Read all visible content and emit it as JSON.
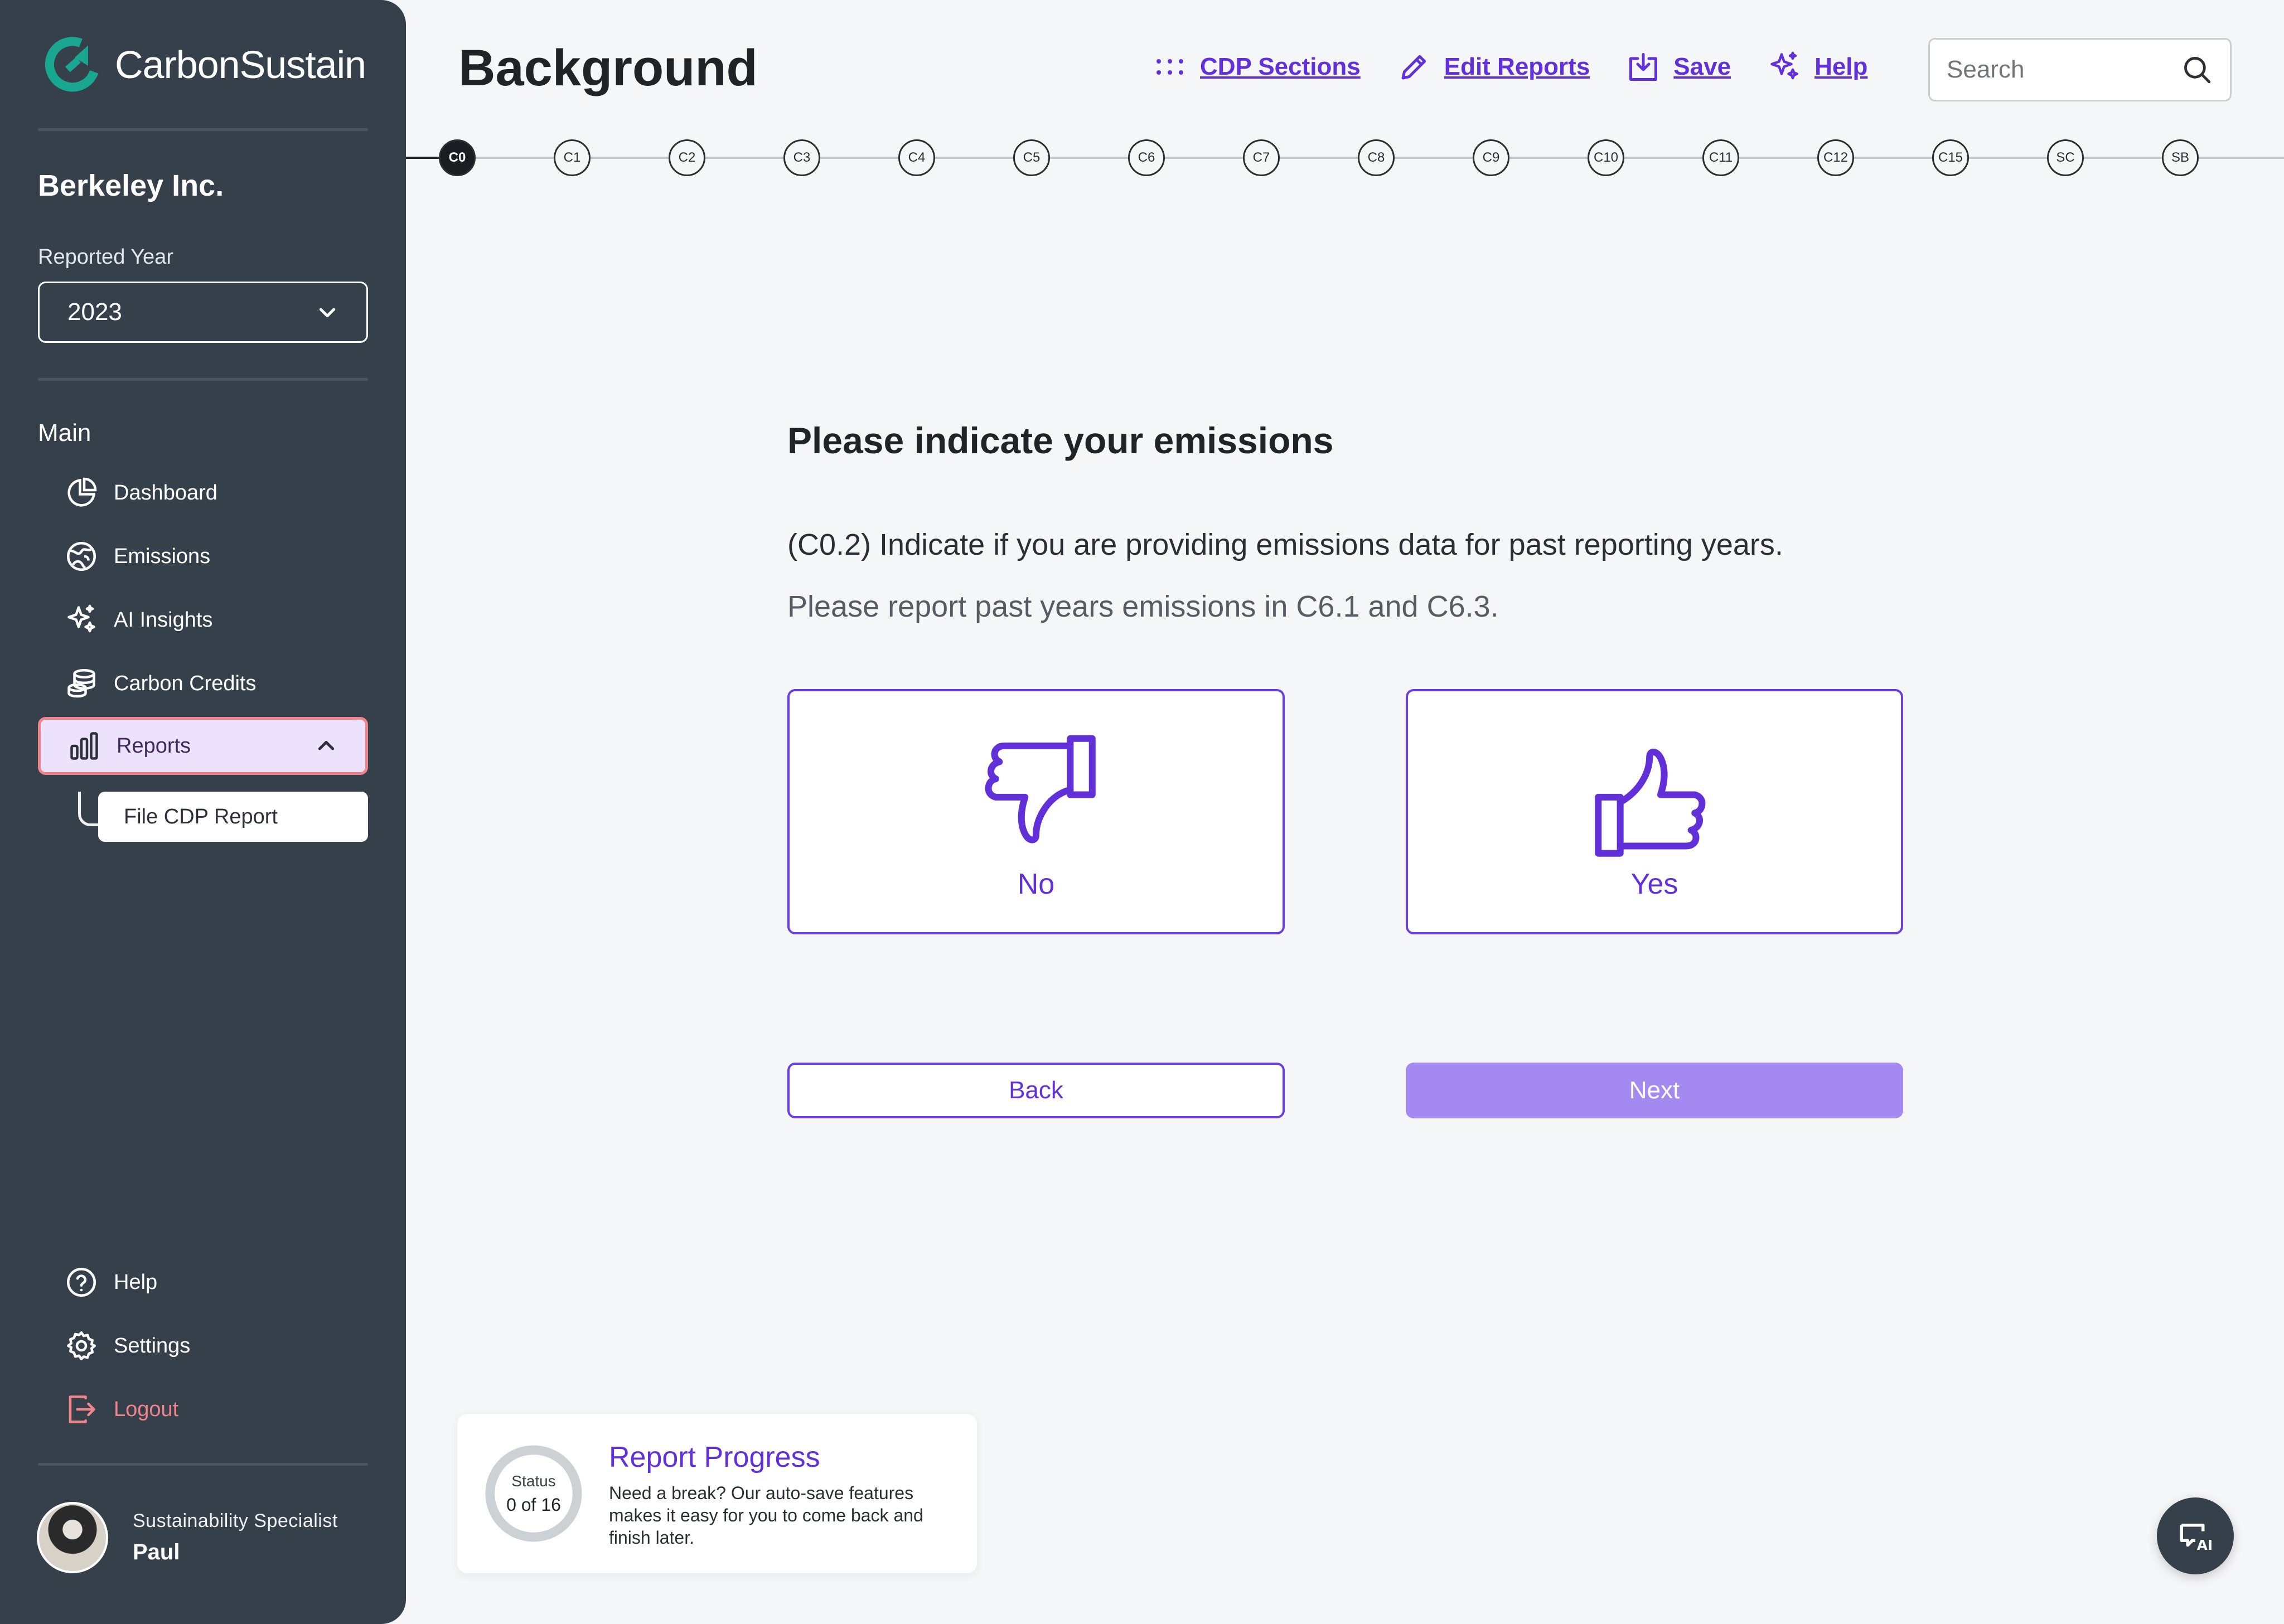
{
  "brand": {
    "name": "CarbonSustain",
    "accent": "#6230d9",
    "logo_color": "#1aa792"
  },
  "sidebar": {
    "company": "Berkeley Inc.",
    "year_label": "Reported Year",
    "year_value": "2023",
    "main_label": "Main",
    "items": [
      {
        "label": "Dashboard",
        "icon": "pie-chart-icon"
      },
      {
        "label": "Emissions",
        "icon": "globe-icon"
      },
      {
        "label": "AI Insights",
        "icon": "sparkles-icon"
      },
      {
        "label": "Carbon Credits",
        "icon": "coins-icon"
      },
      {
        "label": "Reports",
        "icon": "bar-chart-icon",
        "active": true,
        "expanded": true
      }
    ],
    "sub_items": [
      {
        "label": "File CDP Report"
      }
    ],
    "bottom_items": [
      {
        "label": "Help",
        "icon": "help-circle-icon"
      },
      {
        "label": "Settings",
        "icon": "gear-icon"
      },
      {
        "label": "Logout",
        "icon": "logout-icon",
        "color": "#f0848c"
      }
    ],
    "user": {
      "role": "Sustainability Specialist",
      "name": "Paul"
    }
  },
  "header": {
    "title": "Background",
    "toolbar": [
      {
        "label": "CDP Sections",
        "icon": "grid-dots-icon"
      },
      {
        "label": "Edit Reports",
        "icon": "pencil-icon"
      },
      {
        "label": "Save",
        "icon": "save-icon"
      },
      {
        "label": "Help",
        "icon": "sparkles-icon"
      }
    ],
    "search": {
      "placeholder": "Search",
      "value": ""
    }
  },
  "stepper": {
    "current": "C0",
    "steps": [
      "C0",
      "C1",
      "C2",
      "C3",
      "C4",
      "C5",
      "C6",
      "C7",
      "C8",
      "C9",
      "C10",
      "C11",
      "C12",
      "C15",
      "SC",
      "SB"
    ]
  },
  "question": {
    "heading": "Please indicate your emissions",
    "text": "(C0.2) Indicate if you are providing emissions data for past reporting years.",
    "hint": "Please report past years emissions in C6.1 and C6.3.",
    "options": [
      {
        "label": "No",
        "icon": "thumbs-down-icon"
      },
      {
        "label": "Yes",
        "icon": "thumbs-up-icon"
      }
    ],
    "back_label": "Back",
    "next_label": "Next"
  },
  "progress": {
    "status_label": "Status",
    "status_value": "0 of 16",
    "completed_fraction": 0,
    "title": "Report Progress",
    "description": "Need a break? Our auto-save features makes it easy for you to come back and finish later."
  },
  "fab": {
    "icon": "ai-chat-icon"
  }
}
